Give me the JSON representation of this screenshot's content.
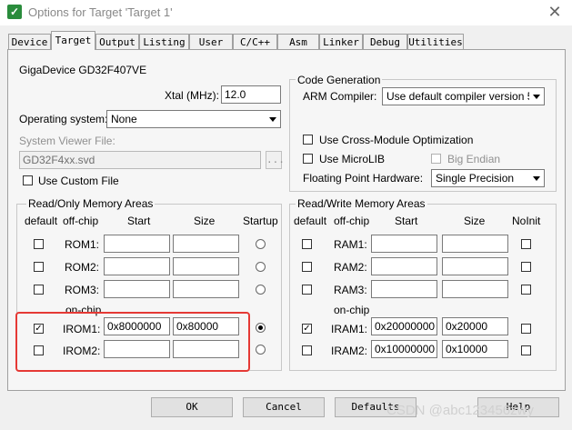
{
  "window": {
    "title": "Options for Target 'Target 1'",
    "close_symbol": "✕",
    "app_icon": "✓"
  },
  "tabs": [
    "Device",
    "Target",
    "Output",
    "Listing",
    "User",
    "C/C++",
    "Asm",
    "Linker",
    "Debug",
    "Utilities"
  ],
  "device": "GigaDevice GD32F407VE",
  "xtal": {
    "label": "Xtal (MHz):",
    "value": "12.0"
  },
  "os": {
    "label": "Operating system:",
    "value": "None"
  },
  "svd": {
    "label": "System Viewer File:",
    "value": "GD32F4xx.svd",
    "browse": "..."
  },
  "custom_file": {
    "label": "Use Custom File",
    "checked": false
  },
  "codegen": {
    "title": "Code Generation",
    "arm_compiler_label": "ARM Compiler:",
    "arm_compiler_value": "Use default compiler version 5",
    "cross_module": "Use Cross-Module Optimization",
    "microlib": "Use MicroLIB",
    "big_endian": "Big Endian",
    "fph_label": "Floating Point Hardware:",
    "fph_value": "Single Precision"
  },
  "rom": {
    "title": "Read/Only Memory Areas",
    "headers": {
      "default": "default",
      "offchip": "off-chip",
      "start": "Start",
      "size": "Size",
      "startup": "Startup"
    },
    "onchip": "on-chip",
    "rows": [
      {
        "name": "ROM1:",
        "start": "",
        "size": "",
        "default": false,
        "startup": false
      },
      {
        "name": "ROM2:",
        "start": "",
        "size": "",
        "default": false,
        "startup": false
      },
      {
        "name": "ROM3:",
        "start": "",
        "size": "",
        "default": false,
        "startup": false
      },
      {
        "name": "IROM1:",
        "start": "0x8000000",
        "size": "0x80000",
        "default": true,
        "startup": true
      },
      {
        "name": "IROM2:",
        "start": "",
        "size": "",
        "default": false,
        "startup": false
      }
    ]
  },
  "ram": {
    "title": "Read/Write Memory Areas",
    "headers": {
      "default": "default",
      "offchip": "off-chip",
      "start": "Start",
      "size": "Size",
      "noinit": "NoInit"
    },
    "onchip": "on-chip",
    "rows": [
      {
        "name": "RAM1:",
        "start": "",
        "size": "",
        "default": false,
        "noinit": false
      },
      {
        "name": "RAM2:",
        "start": "",
        "size": "",
        "default": false,
        "noinit": false
      },
      {
        "name": "RAM3:",
        "start": "",
        "size": "",
        "default": false,
        "noinit": false
      },
      {
        "name": "IRAM1:",
        "start": "0x20000000",
        "size": "0x20000",
        "default": true,
        "noinit": false
      },
      {
        "name": "IRAM2:",
        "start": "0x10000000",
        "size": "0x10000",
        "default": false,
        "noinit": false
      }
    ]
  },
  "buttons": {
    "ok": "OK",
    "cancel": "Cancel",
    "defaults": "Defaults",
    "help": "Help"
  },
  "watermark": "CSDN @abc123456zwy",
  "colors": {
    "highlight": "#e53935",
    "app_icon": "#2a8c3c"
  }
}
